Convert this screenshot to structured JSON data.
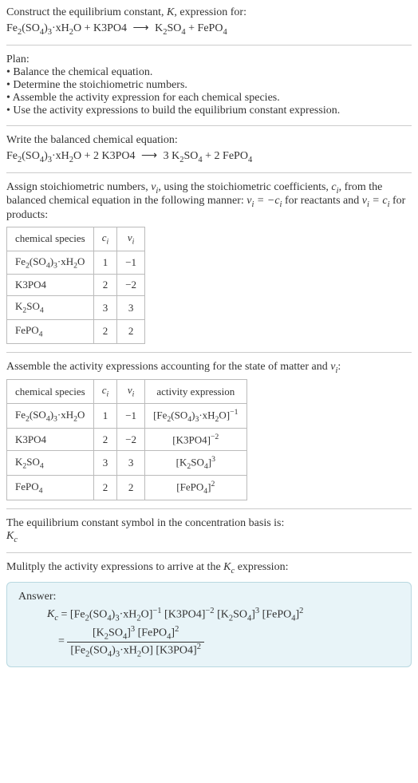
{
  "intro": {
    "line1": "Construct the equilibrium constant, ",
    "K": "K",
    "line1_end": ", expression for:",
    "unbalanced_eq": "Fe₂(SO₄)₃·xH₂O + K3PO4  ⟶  K₂SO₄ + FePO₄"
  },
  "plan": {
    "title": "Plan:",
    "b1": "• Balance the chemical equation.",
    "b2": "• Determine the stoichiometric numbers.",
    "b3": "• Assemble the activity expression for each chemical species.",
    "b4": "• Use the activity expressions to build the equilibrium constant expression."
  },
  "balanced": {
    "title": "Write the balanced chemical equation:",
    "eq": "Fe₂(SO₄)₃·xH₂O + 2 K3PO4  ⟶  3 K₂SO₄ + 2 FePO₄"
  },
  "stoich": {
    "intro1": "Assign stoichiometric numbers, ",
    "vi": "νᵢ",
    "intro2": ", using the stoichiometric coefficients, ",
    "ci": "cᵢ",
    "intro3": ", from the balanced chemical equation in the following manner: ",
    "rel1": "νᵢ = −cᵢ",
    "intro4": " for reactants and ",
    "rel2": "νᵢ = cᵢ",
    "intro5": " for products:"
  },
  "table1": {
    "h1": "chemical species",
    "h2": "cᵢ",
    "h3": "νᵢ",
    "rows": [
      {
        "sp": "Fe₂(SO₄)₃·xH₂O",
        "c": "1",
        "v": "−1"
      },
      {
        "sp": "K3PO4",
        "c": "2",
        "v": "−2"
      },
      {
        "sp": "K₂SO₄",
        "c": "3",
        "v": "3"
      },
      {
        "sp": "FePO₄",
        "c": "2",
        "v": "2"
      }
    ]
  },
  "assemble": {
    "title": "Assemble the activity expressions accounting for the state of matter and ",
    "vi": "νᵢ",
    "end": ":"
  },
  "table2": {
    "h1": "chemical species",
    "h2": "cᵢ",
    "h3": "νᵢ",
    "h4": "activity expression",
    "rows": [
      {
        "sp": "Fe₂(SO₄)₃·xH₂O",
        "c": "1",
        "v": "−1",
        "a": "[Fe₂(SO₄)₃·xH₂O]⁻¹"
      },
      {
        "sp": "K3PO4",
        "c": "2",
        "v": "−2",
        "a": "[K3PO4]⁻²"
      },
      {
        "sp": "K₂SO₄",
        "c": "3",
        "v": "3",
        "a": "[K₂SO₄]³"
      },
      {
        "sp": "FePO₄",
        "c": "2",
        "v": "2",
        "a": "[FePO₄]²"
      }
    ]
  },
  "symbol": {
    "title": "The equilibrium constant symbol in the concentration basis is:",
    "kc": "K",
    "kc_sub": "c"
  },
  "multiply": {
    "title": "Mulitply the activity expressions to arrive at the ",
    "kc": "K",
    "kc_sub": "c",
    "end": " expression:"
  },
  "answer": {
    "label": "Answer:",
    "line1": "Kc = [Fe₂(SO₄)₃·xH₂O]⁻¹ [K3PO4]⁻² [K₂SO₄]³ [FePO₄]²",
    "num": "[K₂SO₄]³ [FePO₄]²",
    "den": "[Fe₂(SO₄)₃·xH₂O] [K3PO4]²",
    "eq_sign": "="
  }
}
